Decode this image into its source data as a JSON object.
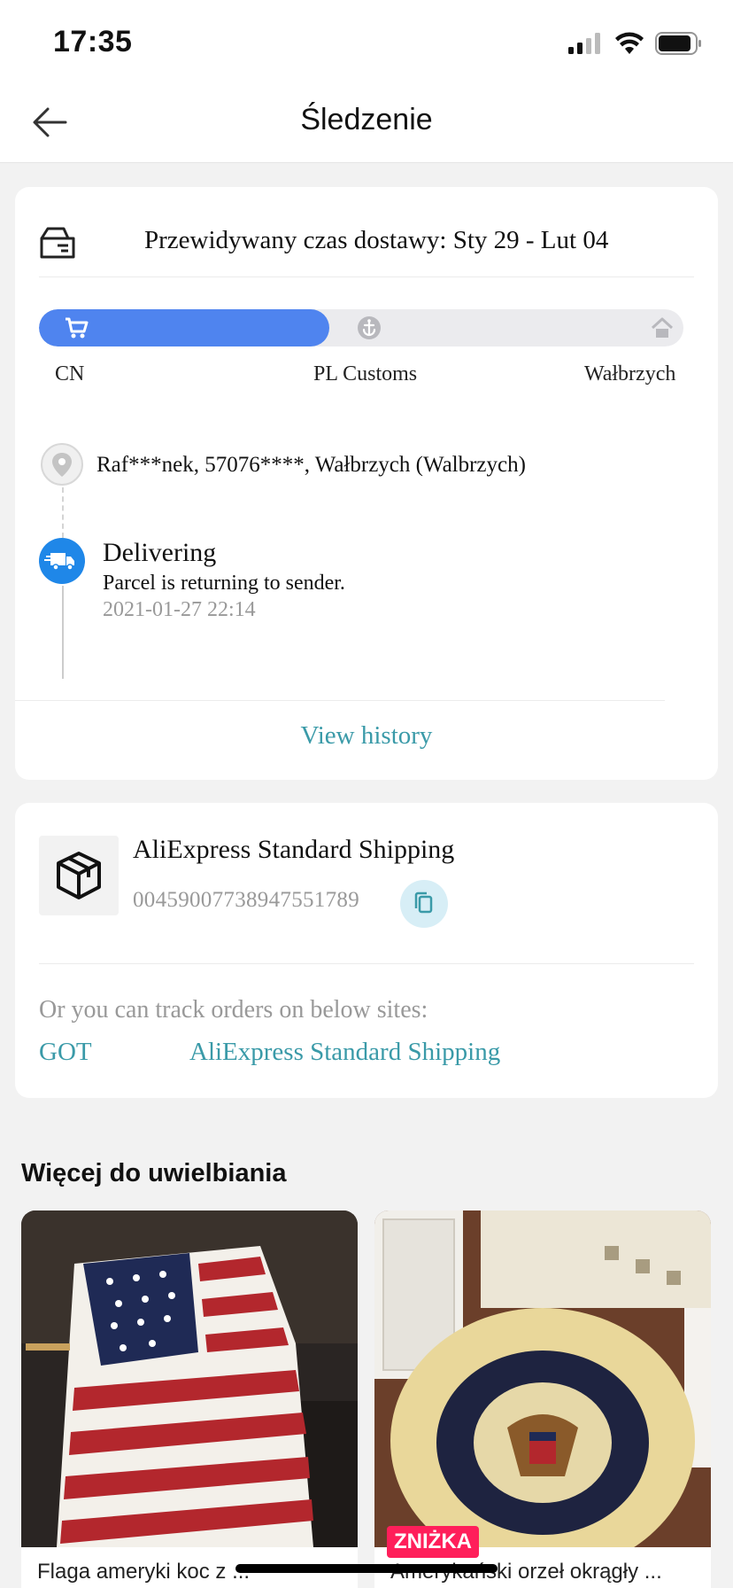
{
  "status_bar": {
    "time": "17:35"
  },
  "header": {
    "title": "Śledzenie"
  },
  "tracking_card": {
    "eta": "Przewidywany czas dostawy: Sty 29 - Lut 04",
    "progress_fraction": 0.45,
    "stages": [
      "CN",
      "PL Customs",
      "Wałbrzych"
    ],
    "address": "Raf***nek,  57076****,  Wałbrzych (Walbrzych)",
    "event": {
      "title": "Delivering",
      "description": "Parcel is returning to sender.",
      "time": "2021-01-27 22:14"
    },
    "view_history": "View history"
  },
  "shipping_card": {
    "carrier": "AliExpress Standard Shipping",
    "tracking_number": "00459007738947551789",
    "track_on_sites_text": "Or you can track orders on below sites:",
    "sites": [
      "GOT",
      "AliExpress Standard Shipping"
    ]
  },
  "recommendations": {
    "title": "Więcej do uwielbiania",
    "products": [
      {
        "name": "Flaga ameryki koc z ...",
        "badge": ""
      },
      {
        "name": "Amerykański orzeł okrągły ...",
        "badge": "ZNIŻKA"
      }
    ]
  },
  "colors": {
    "accent_blue": "#4f84ef",
    "link_teal": "#3a9aa8",
    "badge_red": "#ff1f5a"
  }
}
